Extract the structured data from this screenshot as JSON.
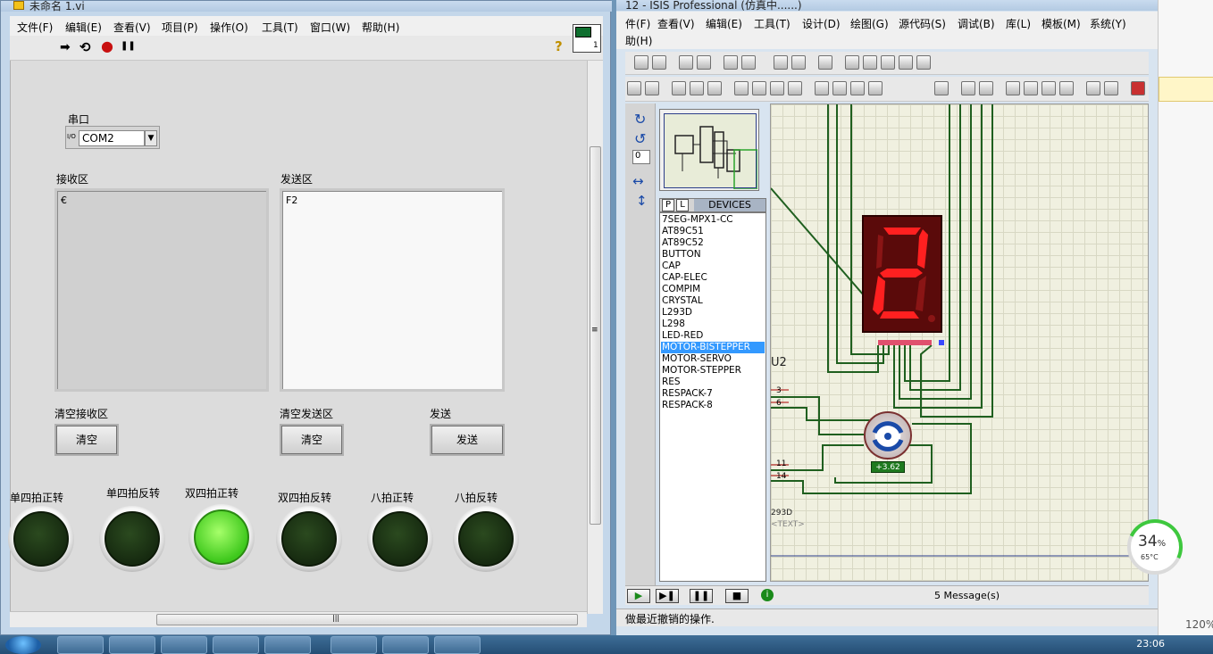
{
  "labview": {
    "title": "未命名 1.vi",
    "menu": [
      "文件(F)",
      "编辑(E)",
      "查看(V)",
      "项目(P)",
      "操作(O)",
      "工具(T)",
      "窗口(W)",
      "帮助(H)"
    ],
    "toolbar": {
      "run_arrow": "➡",
      "run_continuous": "⟲",
      "abort": "●",
      "pause": "❚❚",
      "help": "?"
    },
    "vi_icon_label": "1",
    "serial_port": {
      "label": "串口",
      "io_prefix": "I/O",
      "value": "COM2",
      "arrow": "▼"
    },
    "receive": {
      "label": "接收区",
      "content": "€"
    },
    "send": {
      "label": "发送区",
      "content": "F2"
    },
    "clear_receive": {
      "label": "清空接收区",
      "button": "清空"
    },
    "clear_send": {
      "label": "清空发送区",
      "button": "清空"
    },
    "send_button": {
      "label": "发送",
      "button": "发送"
    },
    "leds": [
      {
        "label": "单四拍正转",
        "on": false
      },
      {
        "label": "单四拍反转",
        "on": false
      },
      {
        "label": "双四拍正转",
        "on": true
      },
      {
        "label": "双四拍反转",
        "on": false
      },
      {
        "label": "八拍正转",
        "on": false
      },
      {
        "label": "八拍反转",
        "on": false
      }
    ],
    "scroll_indicator": "|||",
    "vscroll_mid": "≡"
  },
  "isis": {
    "title": "12 - ISIS Professional (仿真中......)",
    "menu_row1": [
      "件(F)",
      "查看(V)",
      "编辑(E)",
      "工具(T)",
      "设计(D)",
      "绘图(G)",
      "源代码(S)",
      "调试(B)",
      "库(L)",
      "模板(M)",
      "系统(Y)"
    ],
    "menu_row2": [
      "助(H)"
    ],
    "rotation_value": "0",
    "device_tabs": {
      "p": "P",
      "l": "L",
      "title": "DEVICES"
    },
    "devices": [
      "7SEG-MPX1-CC",
      "AT89C51",
      "AT89C52",
      "BUTTON",
      "CAP",
      "CAP-ELEC",
      "COMPIM",
      "CRYSTAL",
      "L293D",
      "L298",
      "LED-RED",
      "MOTOR-BISTEPPER",
      "MOTOR-SERVO",
      "MOTOR-STEPPER",
      "RES",
      "RESPACK-7",
      "RESPACK-8"
    ],
    "selected_device": "MOTOR-BISTEPPER",
    "schematic": {
      "seven_seg_digit": "2",
      "u2_label": "U2",
      "pins": [
        "3",
        "6",
        "11",
        "14"
      ],
      "chip_label": "293D",
      "text_placeholder": "<TEXT>",
      "motor_readout": "+3.62"
    },
    "status": {
      "messages": "5 Message(s)",
      "hint": "做最近撤销的操作."
    }
  },
  "right_strip": {
    "zoom": "120%"
  },
  "perf_widget": {
    "percent": "34",
    "percent_unit": "%",
    "temperature": "65°C"
  },
  "taskbar": {
    "clock": "23:06"
  },
  "colors": {
    "led_on": "#3ec81c",
    "led_off": "#1d3514",
    "seven_seg": "#ff2020",
    "selection": "#3399ff",
    "wire": "#1f5f1f"
  }
}
